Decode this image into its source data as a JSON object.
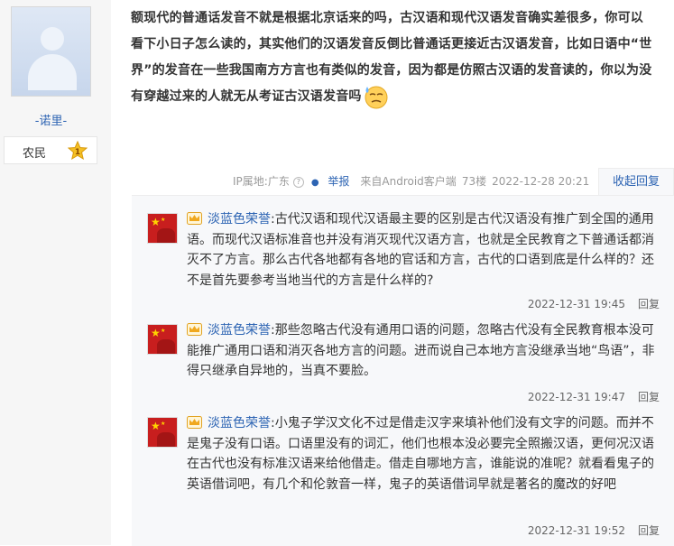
{
  "author": {
    "username": "-诺里-",
    "level_name": "农民",
    "level_number": "1"
  },
  "post": {
    "lines": [
      "额现代的普通话发音不就是根据北京话来的吗，古汉语和现代汉语发音确实差很多，你可以",
      "看下小日子怎么读的，其实他们的汉语发音反倒比普通话更接近古汉语发音，比如日语中“世",
      "界”的发音在一些我国南方方言也有类似的发音，因为都是仿照古汉语的发音读的，你以为没",
      "有穿越过来的人就无从考证古汉语发音吗"
    ],
    "emoji": "sweat-face-emoji"
  },
  "meta": {
    "ip_location": "IP属地:广东",
    "report": "举报",
    "source": "来自Android客户端",
    "floor": "73楼",
    "time": "2022-12-28 20:21",
    "collapse_reply": "收起回复"
  },
  "replies": [
    {
      "name": "淡蓝色荣誉",
      "text": ":古代汉语和现代汉语最主要的区别是古代汉语没有推广到全国的通用语。而现代汉语标准音也并没有消灭现代汉语方言，也就是全民教育之下普通话都消灭不了方言。那么古代各地都有各地的官话和方言，古代的口语到底是什么样的？还不是首先要参考当地当代的方言是什么样的?",
      "time": "2022-12-31 19:45",
      "reply_label": "回复"
    },
    {
      "name": "淡蓝色荣誉",
      "text": ":那些忽略古代没有通用口语的问题，忽略古代没有全民教育根本没可能推广通用口语和消灭各地方言的问题。进而说自己本地方言没继承当地“鸟语”，非得只继承自异地的，当真不要脸。",
      "time": "2022-12-31 19:47",
      "reply_label": "回复"
    },
    {
      "name": "淡蓝色荣誉",
      "text": ":小鬼子学汉文化不过是借走汉字来填补他们没有文字的问题。而并不是鬼子没有口语。口语里没有的词汇，他们也根本没必要完全照搬汉语，更何况汉语在古代也没有标准汉语来给他借走。借走自哪地方言，谁能说的准呢？就看看鬼子的英语借词吧，有几个和伦敦音一样，鬼子的英语借词早就是著名的魔改的好吧",
      "time": "2022-12-31 19:52",
      "reply_label": "回复"
    }
  ],
  "colors": {
    "link_blue": "#2d64b3",
    "sidebar_bg": "#f6f6f6",
    "reply_bg": "#f7f8fa"
  }
}
